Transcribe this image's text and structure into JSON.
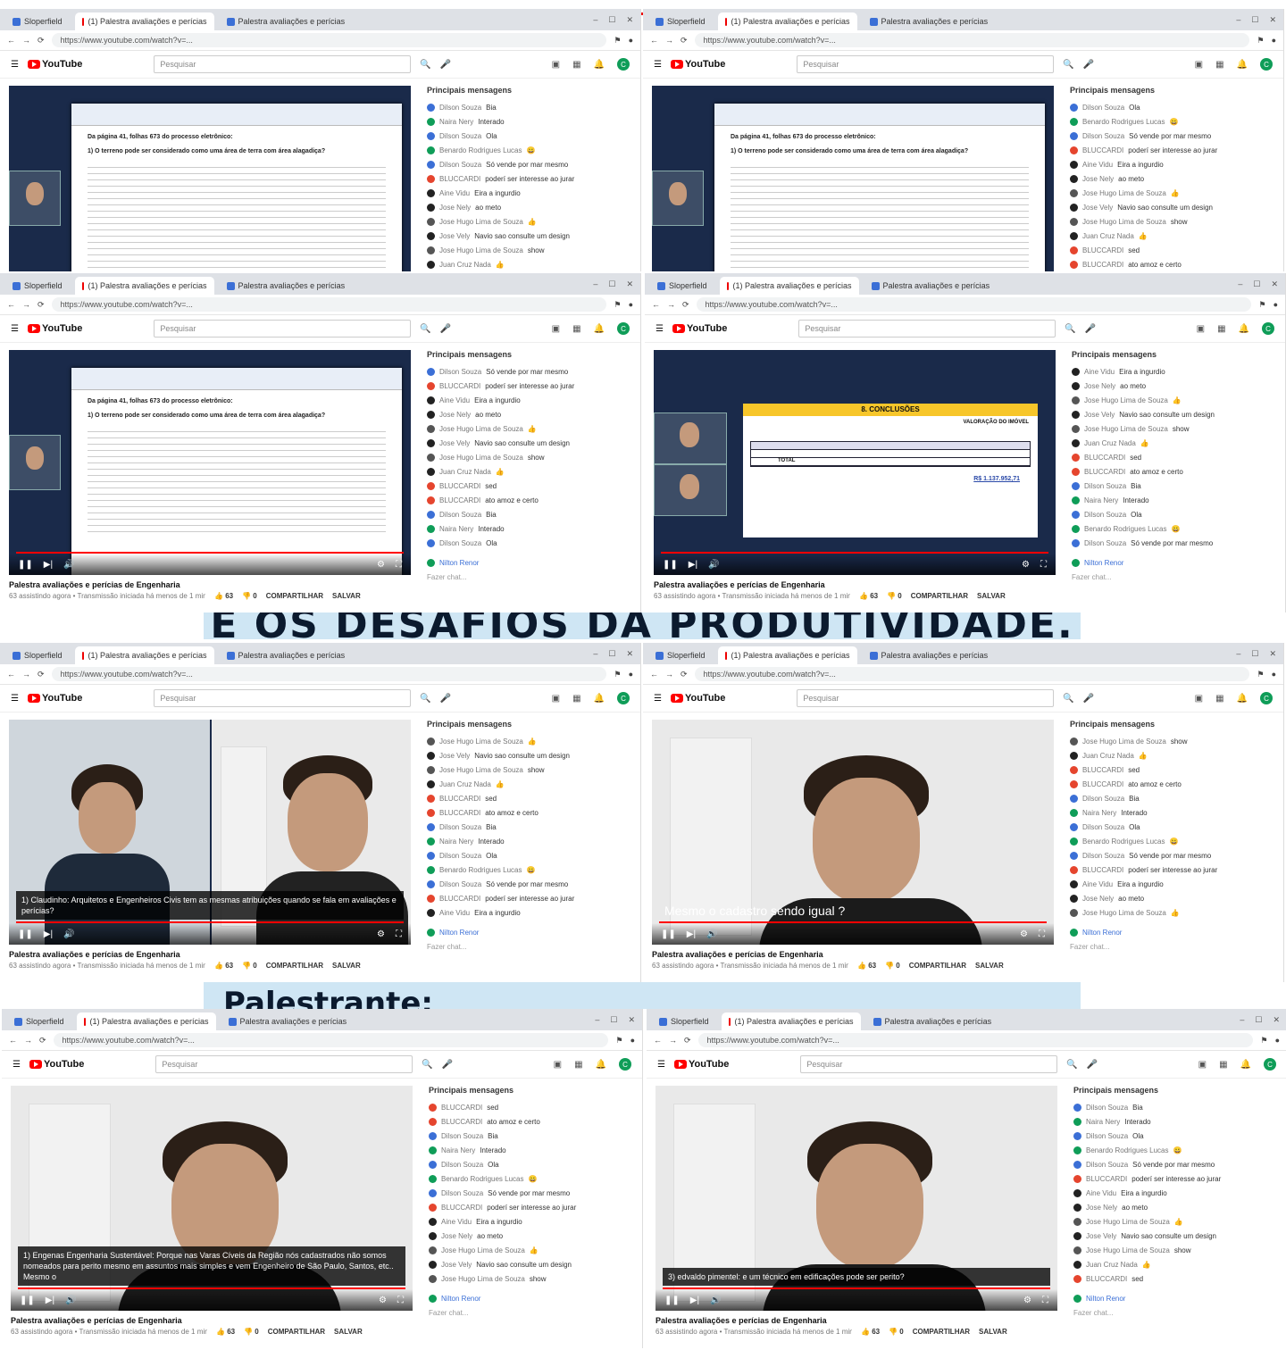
{
  "browser": {
    "tab_search": "Sloperfield",
    "tab_video": "(1) Palestra avaliações e perícias",
    "tab_other": "Palestra avaliações e perícias",
    "url": "https://www.youtube.com/watch?v=..."
  },
  "youtube": {
    "logo_text": "YouTube",
    "search_placeholder": "Pesquisar",
    "avatar_letter": "C"
  },
  "video": {
    "title": "Palestra avaliações e perícias de Engenharia",
    "subtitle": "63 assistindo agora • Transmissão iniciada há menos de 1 minuto",
    "like_count": "63",
    "dislike_count": "0",
    "share": "COMPARTILHAR",
    "save": "SALVAR"
  },
  "chat": {
    "header": "Principais mensagens",
    "messages": [
      {
        "author": "Dilson Souza",
        "text": "Bia",
        "color": "#3b6fd6"
      },
      {
        "author": "Naira Nery",
        "text": "Interado",
        "color": "#0f9d58"
      },
      {
        "author": "Dilson Souza",
        "text": "Ola",
        "color": "#3b6fd6"
      },
      {
        "author": "Benardo Rodrigues Lucas",
        "text": "😀",
        "color": "#0f9d58"
      },
      {
        "author": "Dilson Souza",
        "text": "Só vende por mar mesmo",
        "color": "#3b6fd6"
      },
      {
        "author": "BLUCCARDI",
        "text": "poderí ser interesse ao jurar",
        "color": "#e5452e"
      },
      {
        "author": "Aine Vidu",
        "text": "Eira a ingurdio",
        "color": "#222"
      },
      {
        "author": "Jose Nely",
        "text": "ao meto",
        "color": "#222"
      },
      {
        "author": "Jose Hugo Lima de Souza",
        "text": "👍",
        "color": "#555"
      },
      {
        "author": "Jose Vely",
        "text": "Navio sao consulte um design",
        "color": "#222"
      },
      {
        "author": "Jose Hugo Lima de Souza",
        "text": "show",
        "color": "#555"
      },
      {
        "author": "Juan Cruz Nada",
        "text": "👍",
        "color": "#222"
      },
      {
        "author": "BLUCCARDI",
        "text": "sed",
        "color": "#e5452e"
      },
      {
        "author": "BLUCCARDI",
        "text": "ato amoz e certo",
        "color": "#e5452e"
      }
    ],
    "input_author": "Nilton Renor",
    "input_placeholder": "Fazer chat..."
  },
  "captions": {
    "c1": "1) Claudinho: Arquitetos e Engenheiros Civis tem as mesmas atribuições quando se fala em avaliações e perícias?",
    "c2": "Mesmo o cadastro sendo igual ?",
    "c3": "1) Engenas Engenharia Sustentável: Porque nas Varas Cíveis da Região nós cadastrados não somos nomeados para perito mesmo em assuntos mais simples e vem Engenheiro de São Paulo, Santos, etc.. Mesmo o",
    "c4": "3) edvaldo pimentel: e um técnico em edificações pode ser perito?"
  },
  "slides": {
    "doc_heading": "Da página 41, folhas 673 do processo eletrônico:",
    "doc_q": "1) O terreno pode ser considerado como uma área de terra com área alagadiça?",
    "conclusions": "8. CONCLUSÕES",
    "valuation_label": "VALORAÇÃO DO IMÓVEL",
    "total_label": "TOTAL",
    "total_value": "R$ 1.137.952,71"
  },
  "banners": {
    "b1": "E OS DESAFIOS DA PRODUTIVIDADE.",
    "b2": "Palestrante:"
  }
}
